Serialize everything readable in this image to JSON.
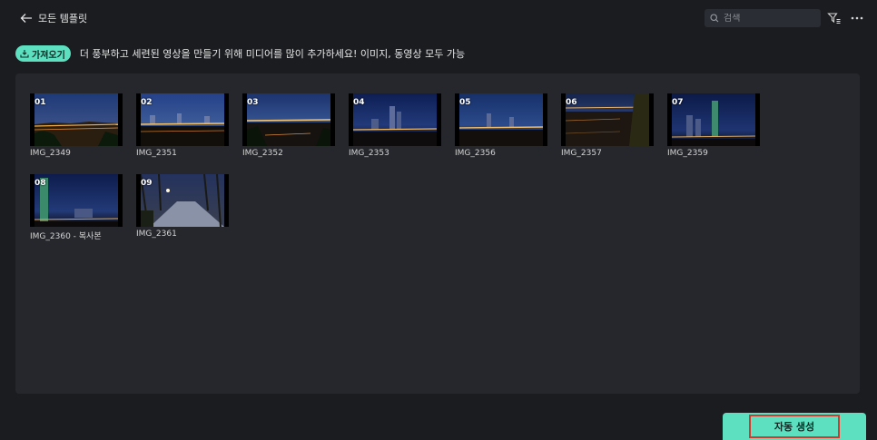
{
  "header": {
    "back_label": "모든 템플릿",
    "search_placeholder": "검색"
  },
  "import": {
    "button_label": "가져오기",
    "hint": "더 풍부하고 세련된 영상을 만들기 위해 미디어를 많이 추가하세요! 이미지, 동영상 모두 가능"
  },
  "media": [
    {
      "num": "01",
      "name": "IMG_2349"
    },
    {
      "num": "02",
      "name": "IMG_2351"
    },
    {
      "num": "03",
      "name": "IMG_2352"
    },
    {
      "num": "04",
      "name": "IMG_2353"
    },
    {
      "num": "05",
      "name": "IMG_2356"
    },
    {
      "num": "06",
      "name": "IMG_2357"
    },
    {
      "num": "07",
      "name": "IMG_2359"
    },
    {
      "num": "08",
      "name": "IMG_2360 - 복사본"
    },
    {
      "num": "09",
      "name": "IMG_2361"
    }
  ],
  "footer": {
    "auto_generate_label": "자동 생성"
  },
  "colors": {
    "accent": "#5ce0c0",
    "background": "#1a1c20",
    "panel": "#25272c",
    "highlight_border": "#d13a2e"
  },
  "icons": {
    "back": "arrow-left-icon",
    "search": "search-icon",
    "filter": "filter-icon",
    "more": "more-horizontal-icon",
    "import": "import-icon"
  }
}
